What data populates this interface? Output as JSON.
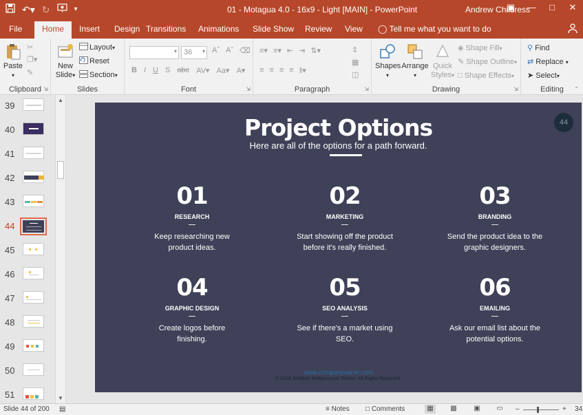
{
  "titlebar": {
    "document_title": "01 - Motagua 4.0 - 16x9 - Light [MAIN]  -  PowerPoint",
    "user_name": "Andrew Childress",
    "qat_icons": [
      "save-icon",
      "undo-icon",
      "redo-icon",
      "start-from-beginning-icon",
      "customize-qat-icon"
    ],
    "window_buttons": [
      "ribbon-display-options-icon",
      "minimize-icon",
      "maximize-icon",
      "close-icon"
    ]
  },
  "tabs": [
    {
      "label": "File"
    },
    {
      "label": "Home"
    },
    {
      "label": "Insert"
    },
    {
      "label": "Design"
    },
    {
      "label": "Transitions"
    },
    {
      "label": "Animations"
    },
    {
      "label": "Slide Show"
    },
    {
      "label": "Review"
    },
    {
      "label": "View"
    }
  ],
  "active_tab": "Home",
  "tell_me": "Tell me what you want to do",
  "ribbon": {
    "clipboard": {
      "label": "Clipboard",
      "paste": "Paste"
    },
    "slides": {
      "label": "Slides",
      "new_slide_line1": "New",
      "new_slide_line2": "Slide",
      "layout": "Layout",
      "reset": "Reset",
      "section": "Section"
    },
    "font": {
      "label": "Font",
      "font_name": "",
      "font_size": "36"
    },
    "paragraph": {
      "label": "Paragraph"
    },
    "drawing": {
      "label": "Drawing",
      "shapes": "Shapes",
      "arrange": "Arrange",
      "quick_styles_line1": "Quick",
      "quick_styles_line2": "Styles",
      "shape_fill": "Shape Fill",
      "shape_outline": "Shape Outline",
      "shape_effects": "Shape Effects"
    },
    "editing": {
      "label": "Editing",
      "find": "Find",
      "replace": "Replace",
      "select": "Select"
    }
  },
  "thumbnails": {
    "numbers": [
      "39",
      "40",
      "41",
      "42",
      "43",
      "44",
      "45",
      "46",
      "47",
      "48",
      "49",
      "50",
      "51"
    ],
    "selected": "44"
  },
  "slide": {
    "title": "Project Options",
    "subtitle": "Here are all of the options for a path forward.",
    "badge": "44",
    "options": [
      {
        "number": "01",
        "label": "RESEARCH",
        "dash": "—",
        "description": "Keep researching new product ideas."
      },
      {
        "number": "02",
        "label": "MARKETING",
        "dash": "—",
        "description": "Start showing off the product before it's really finished."
      },
      {
        "number": "03",
        "label": "BRANDING",
        "dash": "—",
        "description": "Send the product idea to the graphic designers."
      },
      {
        "number": "04",
        "label": "GRAPHIC DESIGN",
        "dash": "—",
        "description": "Create logos before finishing."
      },
      {
        "number": "05",
        "label": "SEO ANALYSIS",
        "dash": "—",
        "description": "See if there's a market using SEO."
      },
      {
        "number": "06",
        "label": "EMAILING",
        "dash": "—",
        "description": "Ask our email list about the potential options."
      }
    ],
    "footer_url": "www.companyname.com",
    "footer_copyright": "© 2016 Jetfabrik Multipurpose Theme. All Rights Reserved."
  },
  "statusbar": {
    "slide_count": "Slide 44 of 200",
    "notes": "Notes",
    "comments": "Comments",
    "zoom": "34"
  },
  "colors": {
    "accent": "#b7472a",
    "slide_background": "#3e4157",
    "selected_thumb_border": "#e06a4c"
  }
}
